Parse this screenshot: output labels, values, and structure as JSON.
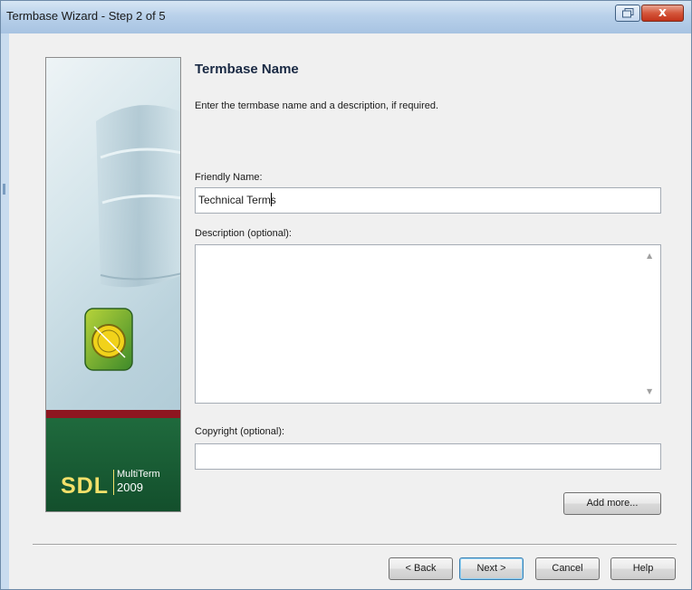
{
  "window": {
    "title": "Termbase Wizard - Step 2 of 5",
    "restore_icon": "restore-icon",
    "close_glyph": "x"
  },
  "sidebar": {
    "logo_brand": "SDL",
    "logo_product": "MultiTerm",
    "logo_year": "2009",
    "colors": {
      "red_band": "#8e1620",
      "green_box": "#1f6a3d",
      "logo_text": "#f3e06a"
    }
  },
  "page": {
    "heading": "Termbase Name",
    "intro": "Enter the termbase name and a description, if required."
  },
  "fields": {
    "friendly_name": {
      "label": "Friendly Name:",
      "value": "Technical Terms"
    },
    "description": {
      "label": "Description (optional):",
      "value": ""
    },
    "copyright": {
      "label": "Copyright (optional):",
      "value": ""
    }
  },
  "buttons": {
    "add_more": "Add more...",
    "back": "< Back",
    "next": "Next >",
    "cancel": "Cancel",
    "help": "Help"
  }
}
